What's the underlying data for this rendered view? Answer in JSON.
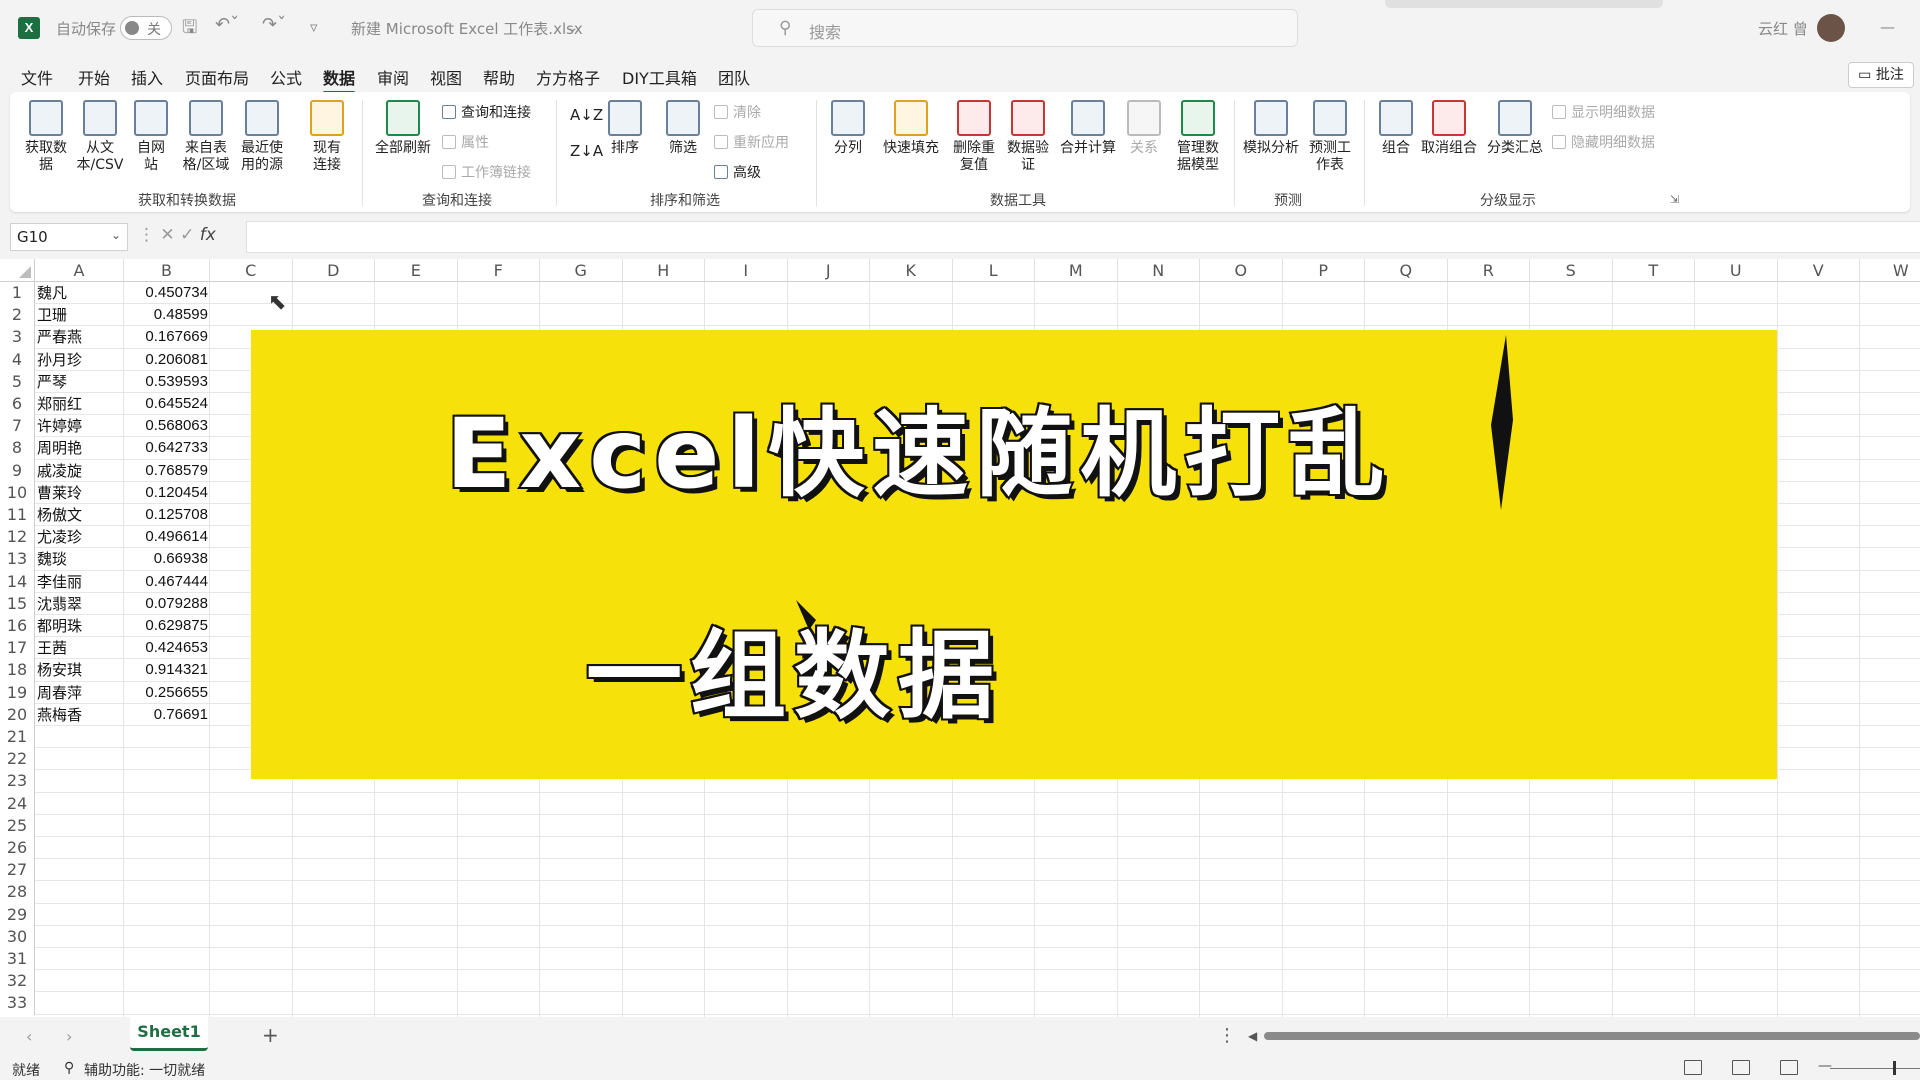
{
  "titlebar": {
    "app_logo": "X",
    "autosave_label": "自动保存",
    "autosave_state": "关",
    "filename": "新建 Microsoft Excel 工作表.xlsx",
    "search_placeholder": "搜索",
    "user_name": "云红 曾",
    "minimize_label": "—"
  },
  "menu": {
    "items": [
      "文件",
      "开始",
      "插入",
      "页面布局",
      "公式",
      "数据",
      "审阅",
      "视图",
      "帮助",
      "方方格子",
      "DIY工具箱",
      "团队"
    ],
    "active": "数据",
    "comment_button": "批注"
  },
  "ribbon": {
    "get_data": "获取数据",
    "from_text": "从文本/CSV",
    "from_web": "自网站",
    "from_table": "来自表格/区域",
    "recent_sources": "最近使用的源",
    "existing_connections": "现有连接",
    "group_get": "获取和转换数据",
    "refresh_all": "全部刷新",
    "queries_connections": "查询和连接",
    "properties": "属性",
    "workbook_links": "工作簿链接",
    "group_queries": "查询和连接",
    "sort": "排序",
    "filter": "筛选",
    "clear": "清除",
    "reapply": "重新应用",
    "advanced": "高级",
    "group_sort": "排序和筛选",
    "text_to_columns": "分列",
    "flash_fill": "快速填充",
    "remove_duplicates": "删除重复值",
    "data_validation": "数据验证",
    "consolidate": "合并计算",
    "relationships": "关系",
    "manage_model": "管理数据模型",
    "group_tools": "数据工具",
    "what_if": "模拟分析",
    "forecast_sheet": "预测工作表",
    "group_forecast": "预测",
    "group_btn": "组合",
    "ungroup": "取消组合",
    "subtotal": "分类汇总",
    "show_detail": "显示明细数据",
    "hide_detail": "隐藏明细数据",
    "group_outline": "分级显示"
  },
  "formula_bar": {
    "name_box": "G10",
    "fx": "fx",
    "formula": ""
  },
  "grid": {
    "columns": [
      "A",
      "B",
      "C",
      "D",
      "E",
      "F",
      "G",
      "H",
      "I",
      "J",
      "K",
      "L",
      "M",
      "N",
      "O",
      "P",
      "Q",
      "R",
      "S",
      "T",
      "U",
      "V",
      "W"
    ],
    "row_numbers": [
      "1",
      "2",
      "3",
      "4",
      "5",
      "6",
      "7",
      "8",
      "9",
      "10",
      "11",
      "12",
      "13",
      "14",
      "15",
      "16",
      "17",
      "18",
      "19",
      "20",
      "21",
      "22",
      "23",
      "24",
      "25",
      "26",
      "27",
      "28",
      "29",
      "30",
      "31",
      "32",
      "33"
    ],
    "rows": [
      {
        "name": "魏凡",
        "value": "0.450734"
      },
      {
        "name": "卫珊",
        "value": "0.48599"
      },
      {
        "name": "严春燕",
        "value": "0.167669"
      },
      {
        "name": "孙月珍",
        "value": "0.206081"
      },
      {
        "name": "严琴",
        "value": "0.539593"
      },
      {
        "name": "郑丽红",
        "value": "0.645524"
      },
      {
        "name": "许婷婷",
        "value": "0.568063"
      },
      {
        "name": "周明艳",
        "value": "0.642733"
      },
      {
        "name": "戚凌旋",
        "value": "0.768579"
      },
      {
        "name": "曹莱玲",
        "value": "0.120454"
      },
      {
        "name": "杨傲文",
        "value": "0.125708"
      },
      {
        "name": "尤凌珍",
        "value": "0.496614"
      },
      {
        "name": "魏琰",
        "value": "0.66938"
      },
      {
        "name": "李佳丽",
        "value": "0.467444"
      },
      {
        "name": "沈翡翠",
        "value": "0.079288"
      },
      {
        "name": "都明珠",
        "value": "0.629875"
      },
      {
        "name": "王茜",
        "value": "0.424653"
      },
      {
        "name": "杨安琪",
        "value": "0.914321"
      },
      {
        "name": "周春萍",
        "value": "0.256655"
      },
      {
        "name": "燕梅香",
        "value": "0.76691"
      }
    ]
  },
  "banner": {
    "line1": "Excel快速随机打乱",
    "line2": "一组数据",
    "background": "#f6e20a"
  },
  "sheets": {
    "tabs": [
      "Sheet1"
    ],
    "add": "+"
  },
  "status": {
    "ready": "就绪",
    "accessibility": "辅助功能: 一切就绪"
  },
  "colors": {
    "accent": "#1d6f42"
  }
}
